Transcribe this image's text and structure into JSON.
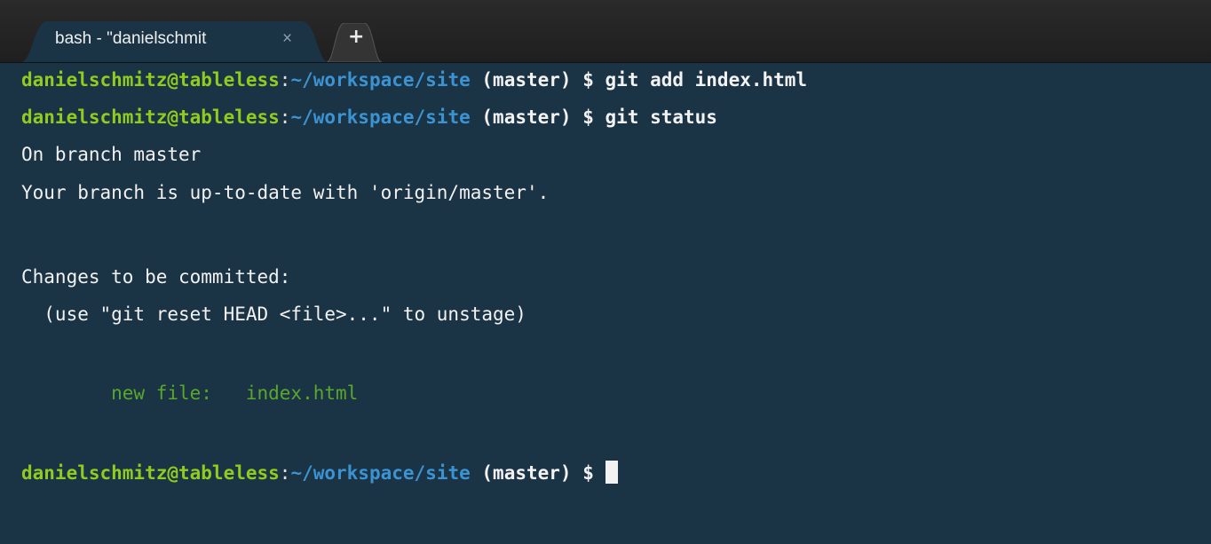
{
  "tabbar": {
    "tab_title": "bash - \"danielschmit",
    "close_glyph": "×",
    "new_tab_glyph": "+"
  },
  "terminal": {
    "prompt_user": "danielschmitz@tableless",
    "prompt_colon": ":",
    "prompt_path": "~/workspace/site",
    "prompt_branch": "(master) $",
    "commands": [
      "git add index.html",
      "git status"
    ],
    "output": {
      "on_branch": "On branch master",
      "up_to_date": "Your branch is up-to-date with 'origin/master'.",
      "changes_header": "Changes to be committed:",
      "hint": "  (use \"git reset HEAD <file>...\" to unstage)",
      "staged_entry": "        new file:   index.html"
    }
  },
  "colors": {
    "background": "#1a3345",
    "user": "#8fcc1f",
    "path": "#3c93d2",
    "staged": "#58a82c",
    "text": "#f2f2f2"
  }
}
